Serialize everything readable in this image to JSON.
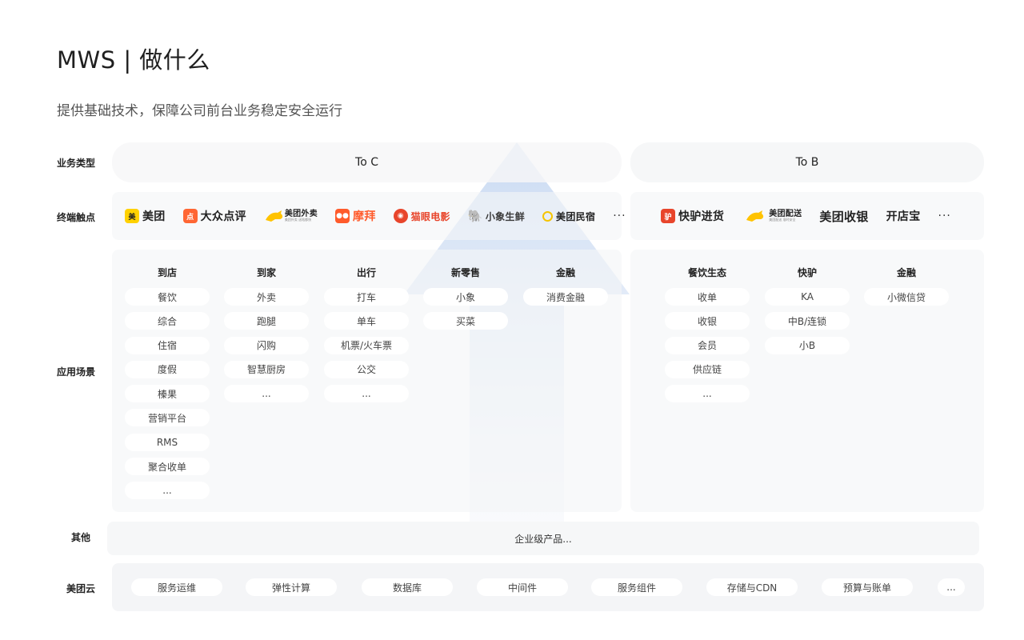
{
  "header": {
    "title": "MWS | 做什么",
    "subtitle": "提供基础技术，保障公司前台业务稳定安全运行"
  },
  "row_labels": {
    "business_type": "业务类型",
    "touchpoints": "终端触点",
    "scenarios": "应用场景",
    "other": "其他",
    "cloud": "美团云"
  },
  "business_types": {
    "to_c": "To C",
    "to_b": "To B"
  },
  "touchpoints": {
    "to_c": [
      {
        "name": "美团",
        "icon": "meituan-logo"
      },
      {
        "name": "大众点评",
        "icon": "dianping-logo"
      },
      {
        "name": "美团外卖",
        "icon": "kangaroo-logo",
        "tagline": "美团外卖 送啥都快"
      },
      {
        "name": "摩拜",
        "icon": "mobike-logo"
      },
      {
        "name": "猫眼电影",
        "icon": "maoyan-logo"
      },
      {
        "name": "小象生鲜",
        "icon": "elephant-logo"
      },
      {
        "name": "美团民宿",
        "icon": "minsu-logo"
      }
    ],
    "to_c_more": "···",
    "to_b": [
      {
        "name": "快驴进货",
        "icon": "kuailv-logo"
      },
      {
        "name": "美团配送",
        "icon": "kangaroo-logo",
        "tagline": "美团配送 准时安全"
      },
      {
        "name": "美团收银",
        "icon": ""
      },
      {
        "name": "开店宝",
        "icon": ""
      }
    ],
    "to_b_more": "···"
  },
  "scenarios": {
    "to_c": [
      {
        "header": "到店",
        "items": [
          "餐饮",
          "综合",
          "住宿",
          "度假",
          "榛果",
          "营销平台",
          "RMS",
          "聚合收单",
          "..."
        ]
      },
      {
        "header": "到家",
        "items": [
          "外卖",
          "跑腿",
          "闪购",
          "智慧厨房",
          "..."
        ]
      },
      {
        "header": "出行",
        "items": [
          "打车",
          "单车",
          "机票/火车票",
          "公交",
          "..."
        ]
      },
      {
        "header": "新零售",
        "items": [
          "小象",
          "买菜"
        ]
      },
      {
        "header": "金融",
        "items": [
          "消费金融"
        ]
      }
    ],
    "to_b": [
      {
        "header": "餐饮生态",
        "items": [
          "收单",
          "收银",
          "会员",
          "供应链",
          "..."
        ]
      },
      {
        "header": "快驴",
        "items": [
          "KA",
          "中B/连锁",
          "小B"
        ]
      },
      {
        "header": "金融",
        "items": [
          "小微信贷"
        ]
      }
    ]
  },
  "other": {
    "text": "企业级产品..."
  },
  "cloud": {
    "items": [
      "服务运维",
      "弹性计算",
      "数据库",
      "中间件",
      "服务组件",
      "存储与CDN",
      "预算与账单",
      "..."
    ]
  },
  "colors": {
    "panel": "#f4f5f7",
    "arrow_top": "#c9daf3",
    "arrow_bottom": "#eef2f8",
    "meituan_yellow": "#ffd100",
    "dianping_orange": "#ff6633",
    "mobike_orange": "#ff5b2b",
    "maoyan_red": "#e8452b",
    "elephant_brown": "#7a4f2a",
    "minsu_yellow": "#f5c400",
    "kuailv_red": "#e8452b"
  }
}
